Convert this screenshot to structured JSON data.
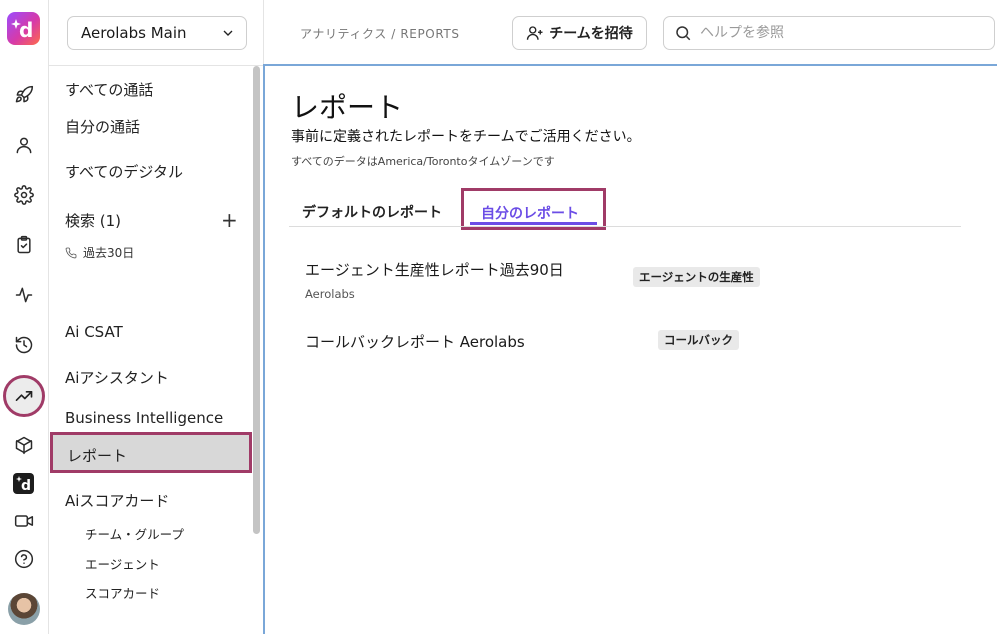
{
  "workspace": {
    "name": "Aerolabs Main"
  },
  "topbar": {
    "breadcrumb": "アナリティクス / REPORTS",
    "invite_label": "チームを招待",
    "search_placeholder": "ヘルプを参照"
  },
  "sidebar": {
    "all_calls": "すべての通話",
    "my_calls": "自分の通話",
    "all_digital": "すべてのデジタル",
    "search_label": "検索 (1)",
    "search_add": "+",
    "recent_filter": "過去30日",
    "ai_csat": "Ai CSAT",
    "ai_assistant": "Aiアシスタント",
    "business_intelligence": "Business Intelligence",
    "reports": "レポート",
    "ai_scorecard": "Aiスコアカード",
    "team_group": "チーム・グループ",
    "agent": "エージェント",
    "scorecard": "スコアカード"
  },
  "page": {
    "title": "レポート",
    "subtitle": "事前に定義されたレポートをチームでご活用ください。",
    "timezone_note": "すべてのデータはAmerica/Torontoタイムゾーンです"
  },
  "tabs": {
    "default_label": "デフォルトのレポート",
    "mine_label": "自分のレポート"
  },
  "reports": [
    {
      "name": "エージェント生産性レポート過去90日",
      "owner": "Aerolabs",
      "category": "エージェントの生産性"
    },
    {
      "name": "コールバックレポート Aerolabs",
      "owner": "",
      "category": "コールバック"
    }
  ],
  "colors": {
    "accent": "#6b4de6",
    "highlight": "#a03b67"
  },
  "icons": {
    "rail": [
      "logo-icon",
      "rocket-icon",
      "person-icon",
      "gear-icon",
      "clipboard-icon",
      "pulse-icon",
      "history-icon",
      "trending-up-icon",
      "cube-icon",
      "dialpad-icon",
      "video-icon",
      "help-icon"
    ]
  }
}
